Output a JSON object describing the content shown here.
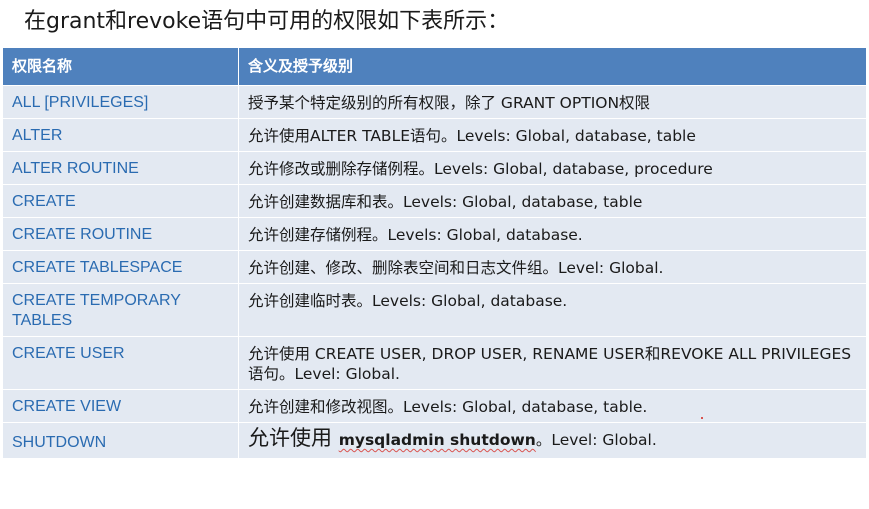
{
  "heading": "在grant和revoke语句中可用的权限如下表所示：",
  "table": {
    "headers": [
      "权限名称",
      "含义及授予级别"
    ],
    "rows": [
      {
        "name": "ALL [PRIVILEGES]",
        "desc": "授予某个特定级别的所有权限，除了 GRANT  OPTION权限"
      },
      {
        "name": "ALTER",
        "desc": "允许使用ALTER  TABLE语句。Levels: Global, database, table"
      },
      {
        "name": "ALTER ROUTINE",
        "desc": "允许修改或删除存储例程。Levels: Global, database, procedure"
      },
      {
        "name": "CREATE",
        "desc": "允许创建数据库和表。Levels: Global, database, table"
      },
      {
        "name": "CREATE ROUTINE",
        "desc": "允许创建存储例程。Levels: Global, database."
      },
      {
        "name": "CREATE TABLESPACE",
        "desc": "允许创建、修改、删除表空间和日志文件组。Level: Global."
      },
      {
        "name": "CREATE TEMPORARY TABLES",
        "desc": "允许创建临时表。Levels: Global, database."
      },
      {
        "name": "CREATE USER",
        "desc": "允许使用 CREATE USER, DROP USER, RENAME USER和REVOKE ALL PRIVILEGES语句。Level: Global."
      },
      {
        "name": "CREATE VIEW",
        "desc": "允许创建和修改视图。Levels: Global, database, table."
      }
    ],
    "last_row": {
      "name": "SHUTDOWN",
      "desc_lead": "允许使用 ",
      "desc_cmd": "mysqladmin shutdown",
      "desc_tail": "。Level: Global."
    }
  }
}
